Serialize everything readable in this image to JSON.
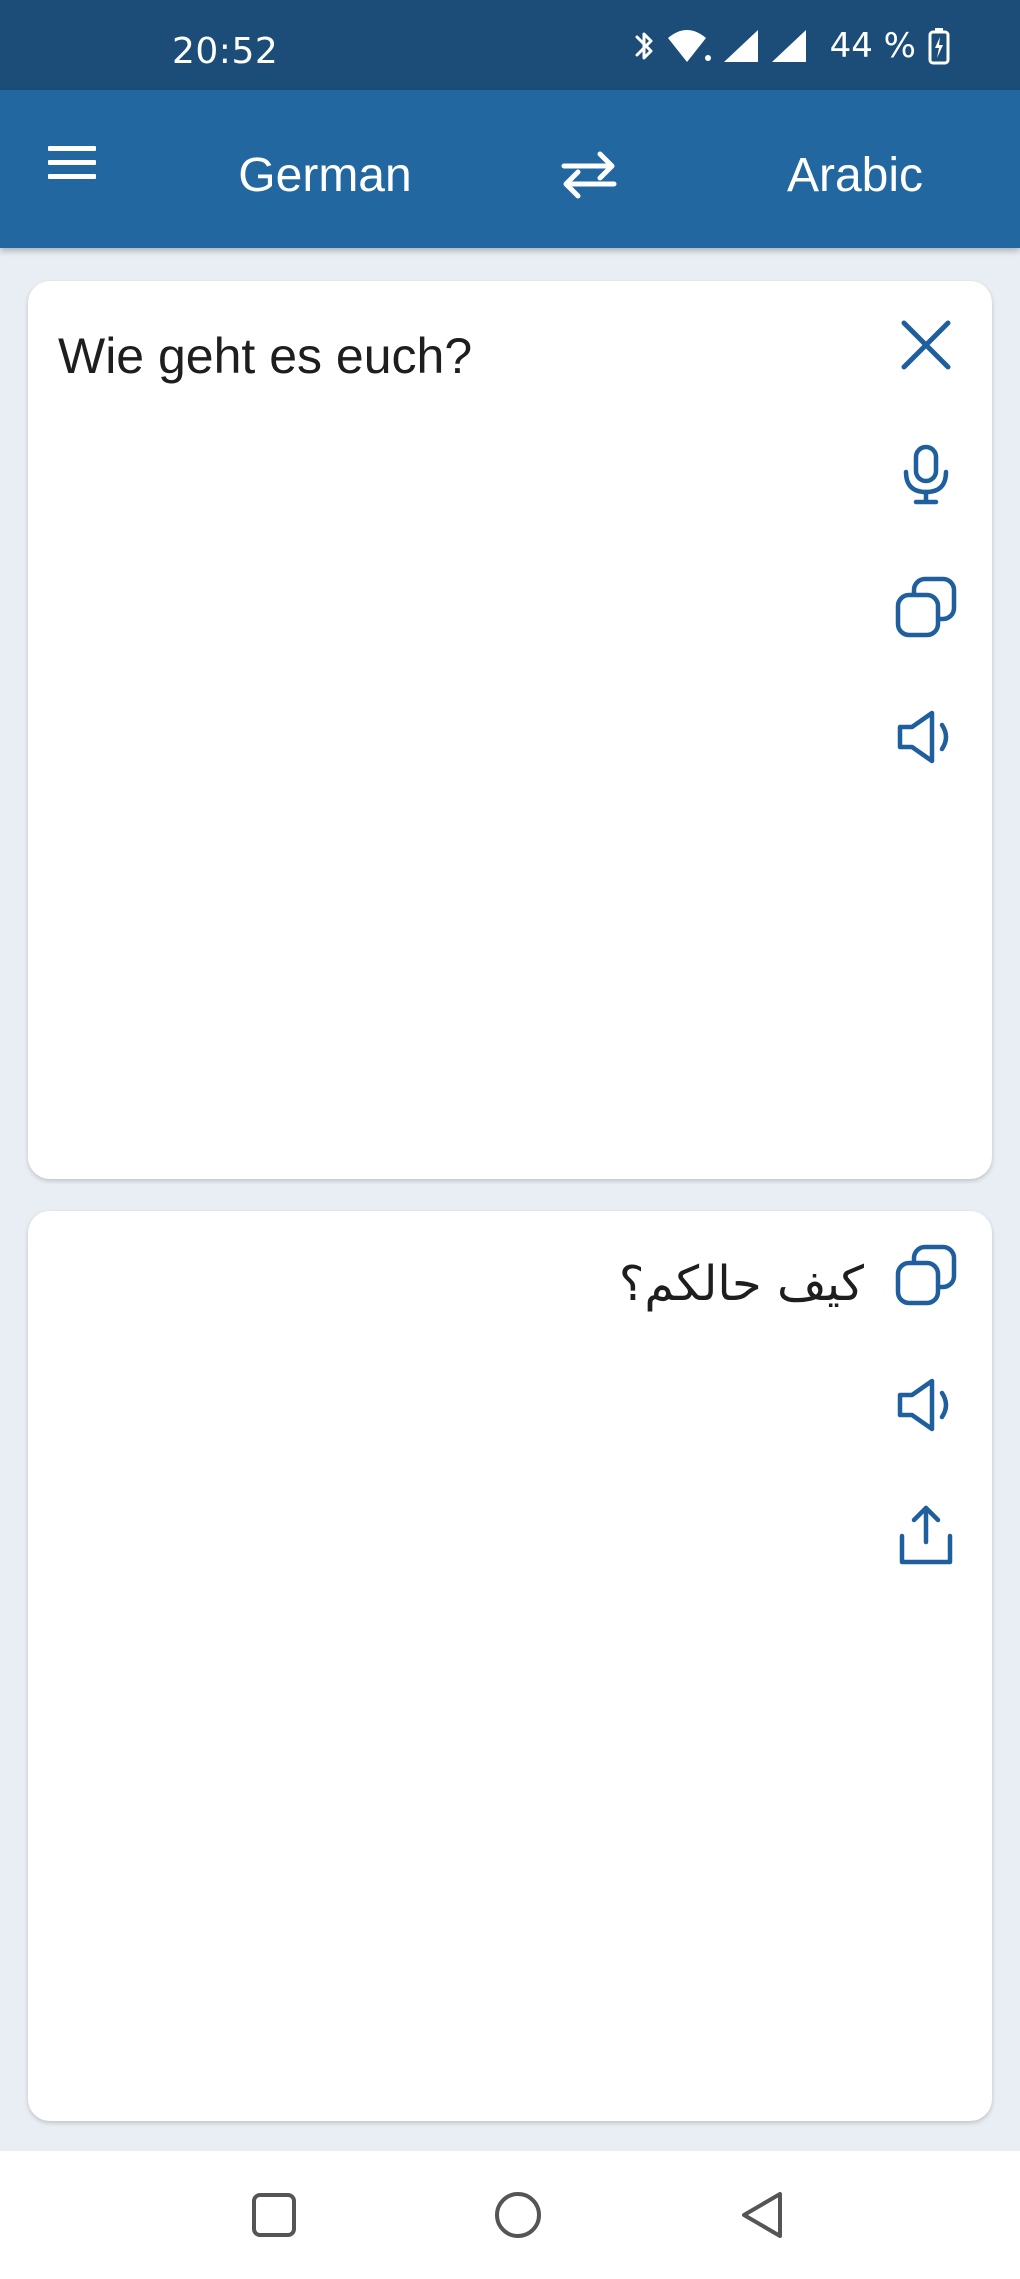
{
  "status_bar": {
    "time": "20:52",
    "battery": "44 %",
    "icons": [
      "bluetooth-icon",
      "wifi-icon",
      "signal-icon",
      "signal-icon",
      "battery-charging-icon"
    ]
  },
  "toolbar": {
    "menu_icon": "menu-icon",
    "source_language": "German",
    "swap_icon": "swap-icon",
    "target_language": "Arabic"
  },
  "source_card": {
    "text": "Wie geht es euch?",
    "actions": [
      "close-icon",
      "microphone-icon",
      "copy-icon",
      "speaker-icon"
    ]
  },
  "target_card": {
    "text": "كيف حالكم؟",
    "actions": [
      "copy-icon",
      "speaker-icon",
      "share-icon"
    ]
  },
  "nav_bar": {
    "buttons": [
      "recents-icon",
      "home-icon",
      "back-icon"
    ]
  },
  "colors": {
    "status_bar": "#1b4d78",
    "toolbar": "#2267a0",
    "accent_icon": "#1f5f9e",
    "background": "#e9eef4"
  }
}
